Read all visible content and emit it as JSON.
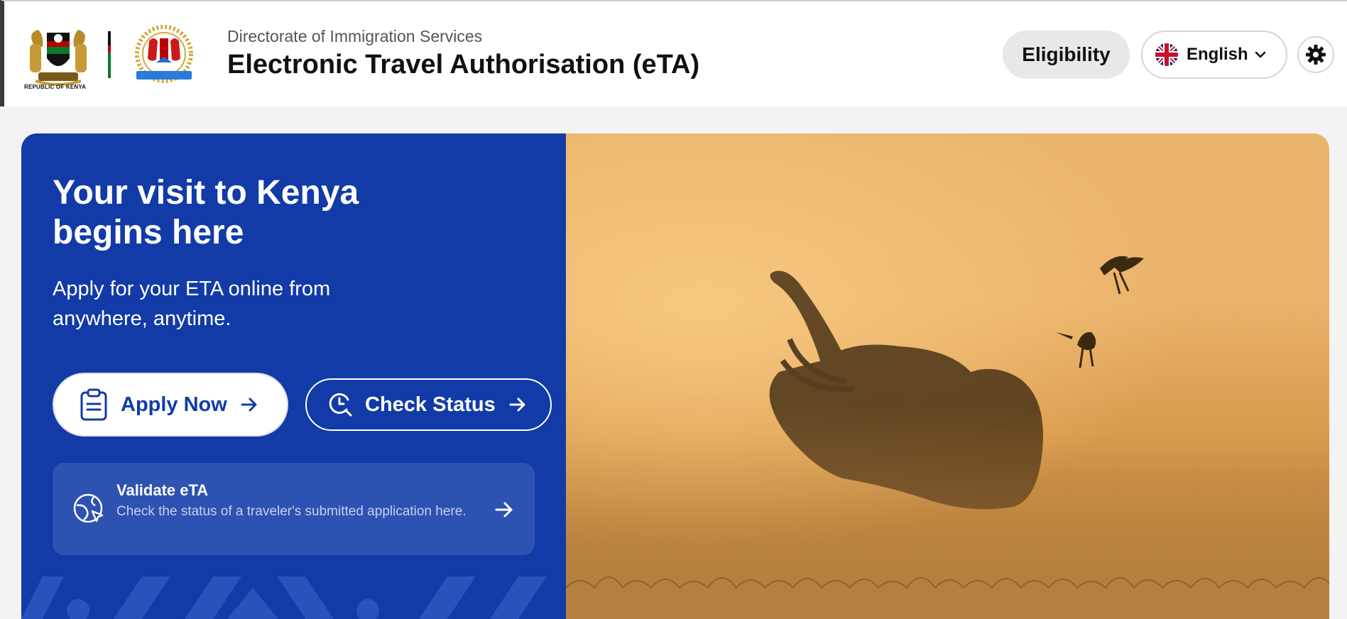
{
  "header": {
    "coat_label": "REPUBLIC OF KENYA",
    "subtitle": "Directorate of Immigration Services",
    "title": "Electronic Travel Authorisation (eTA)",
    "eligibility_label": "Eligibility",
    "language": {
      "selected": "English",
      "flag_icon": "uk-flag-icon"
    },
    "settings_icon": "gear-icon"
  },
  "hero": {
    "title": "Your visit to Kenya begins here",
    "description": "Apply for your ETA online from anywhere, anytime.",
    "apply_button": {
      "label": "Apply Now",
      "icon": "clipboard-icon"
    },
    "check_button": {
      "label": "Check Status",
      "icon": "status-search-icon"
    },
    "validate_card": {
      "title": "Validate eTA",
      "description": "Check the status of a traveler's submitted application here.",
      "icon": "globe-cursor-icon"
    },
    "image_alt": "Elephant with birds in golden mist"
  },
  "colors": {
    "brand_blue": "#123ba8",
    "accent_gold": "#e9b46a",
    "header_bg": "#ffffff"
  }
}
